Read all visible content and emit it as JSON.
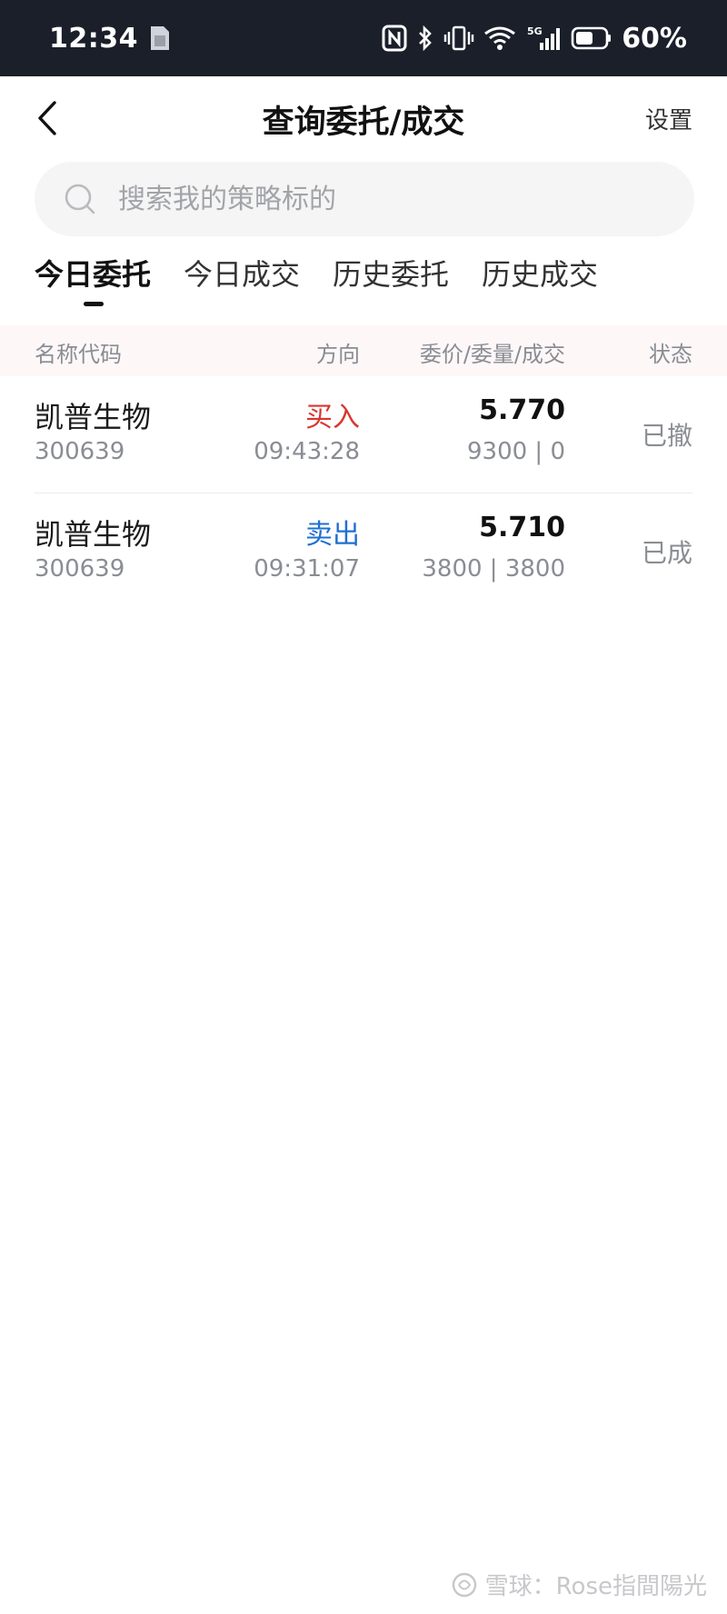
{
  "status_bar": {
    "time": "12:34",
    "signal": "5G",
    "battery": "60%"
  },
  "header": {
    "title": "查询委托/成交",
    "settings_label": "设置"
  },
  "search": {
    "placeholder": "搜索我的策略标的",
    "value": ""
  },
  "tabs": [
    {
      "label": "今日委托",
      "active": true
    },
    {
      "label": "今日成交",
      "active": false
    },
    {
      "label": "历史委托",
      "active": false
    },
    {
      "label": "历史成交",
      "active": false
    }
  ],
  "table": {
    "headers": {
      "name": "名称代码",
      "direction": "方向",
      "price_qty": "委价/委量/成交",
      "status": "状态"
    },
    "rows": [
      {
        "name": "凯普生物",
        "code": "300639",
        "direction": "买入",
        "time": "09:43:28",
        "price": "5.770",
        "qty": "9300 | 0",
        "status": "已撤"
      },
      {
        "name": "凯普生物",
        "code": "300639",
        "direction": "卖出",
        "time": "09:31:07",
        "price": "5.710",
        "qty": "3800 | 3800",
        "status": "已成"
      }
    ]
  },
  "colors": {
    "buy": "#d8362f",
    "sell": "#1f6fd2",
    "statusbar_bg": "#1a1f2a"
  },
  "watermark": {
    "text": "雪球：Rose指間陽光"
  }
}
